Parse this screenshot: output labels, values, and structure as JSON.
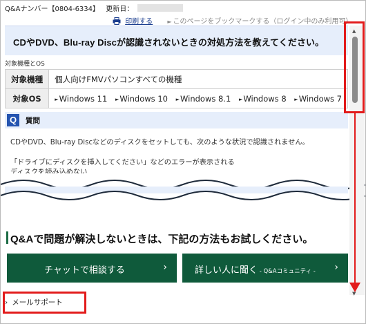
{
  "header": {
    "qa_number": "Q&Aナンバー【0804-6334】",
    "updated_label": "更新日："
  },
  "toolbar": {
    "print_label": "印刷する",
    "bookmark_label": "このページをブックマークする（ログイン中のみ利用可）"
  },
  "title": "CDやDVD、Blu-ray Discが認識されないときの対処方法を教えてください。",
  "section_tag": "対象機種とOS",
  "spec_table": {
    "rows": [
      {
        "label": "対象機種",
        "value": "個人向けFMVパソコンすべての機種"
      },
      {
        "label": "対象OS"
      }
    ],
    "os_list": [
      "Windows 11",
      "Windows 10",
      "Windows 8.1",
      "Windows 8",
      "Windows 7"
    ]
  },
  "question": {
    "icon_letter": "Q",
    "label": "質問",
    "line1": "CDやDVD、Blu-ray Discなどのディスクをセットしても、次のような状況で認識されません。",
    "line2": "「ドライブにディスクを挿入してください」などのエラーが表示される",
    "line3": "ディスクを読み込めない"
  },
  "cta": {
    "heading": "Q&Aで問題が解決しないときは、下記の方法もお試しください。",
    "chat_button": "チャットで相談する",
    "ask_button": "詳しい人に聞く",
    "ask_sub": " - Q&Aコミュニティ - ",
    "chevron": "›",
    "mail_label": "メールサポート"
  },
  "colors": {
    "accent_blue": "#2454b0",
    "button_green": "#0f5a3b",
    "annotation_red": "#e21b1b",
    "title_bg": "#e6eefb"
  }
}
